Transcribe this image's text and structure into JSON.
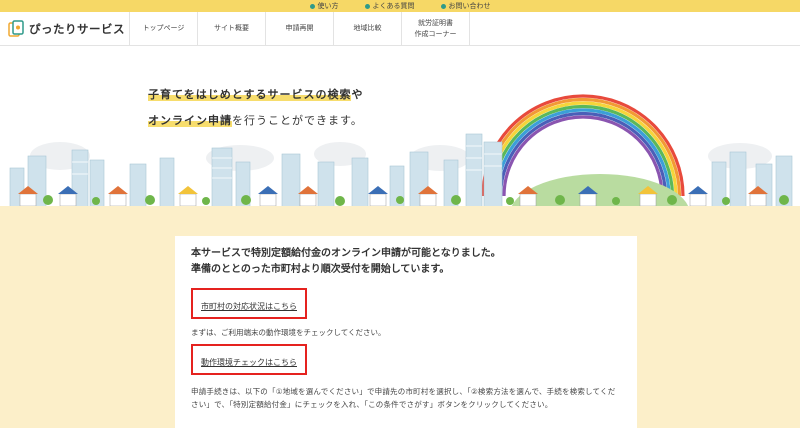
{
  "utility_bar": {
    "items": [
      {
        "label": "使い方",
        "icon": "dot-icon"
      },
      {
        "label": "よくある質問",
        "icon": "dot-icon"
      },
      {
        "label": "お問い合わせ",
        "icon": "dot-icon"
      }
    ]
  },
  "header": {
    "logo_text": "ぴったりサービス",
    "nav": [
      {
        "label": "トップページ"
      },
      {
        "label": "サイト概要"
      },
      {
        "label": "申請再開"
      },
      {
        "label": "地域比較"
      },
      {
        "label": "就労証明書\n作成コーナー"
      }
    ]
  },
  "hero": {
    "line1_highlight": "子育てをはじめとするサービスの検索",
    "line1_rest": "や",
    "line2_highlight": "オンライン申請",
    "line2_rest": "を行うことができます。"
  },
  "notice": {
    "line1": "本サービスで特別定額給付金のオンライン申請が可能となりました。",
    "line2": "準備のととのった市町村より順次受付を開始しています。",
    "link1": "市町村の対応状況はこちら",
    "note": "まずは、ご利用端末の動作環境をチェックしてください。",
    "link2": "動作環境チェックはこちら",
    "instructions": "申請手続きは、以下の「①地域を選んでください」で申請先の市町村を選択し、「②検索方法を選んで、手続を検索してください」で、「特別定額給付金」にチェックを入れ、「この条件でさがす」ボタンをクリックしてください。"
  },
  "colors": {
    "accent_yellow": "#f6d866",
    "background_cream": "#fcefc9",
    "highlight_red": "#e5221f",
    "teal": "#2f9a8a"
  }
}
